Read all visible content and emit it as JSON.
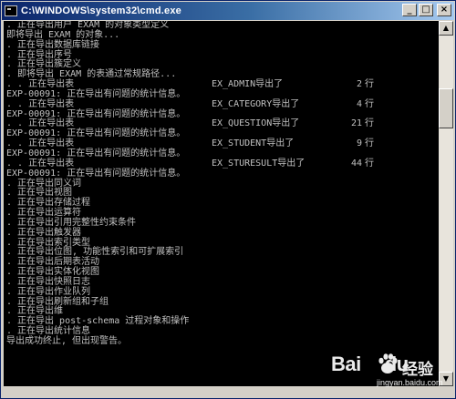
{
  "window": {
    "title": "C:\\WINDOWS\\system32\\cmd.exe",
    "controls": {
      "minimize": "_",
      "maximize": "□",
      "close": "×"
    }
  },
  "console": {
    "lines": [
      {
        "text": ". 正在导出用户 EXAM 的对象类型定义"
      },
      {
        "text": "即将导出 EXAM 的对象..."
      },
      {
        "text": ". 正在导出数据库链接"
      },
      {
        "text": ". 正在导出序号"
      },
      {
        "text": ". 正在导出簇定义"
      },
      {
        "text": ". 即将导出 EXAM 的表通过常规路径..."
      },
      {
        "text": ". . 正在导出表",
        "table": "EX_ADMIN导出了",
        "count": "2",
        "unit": "行"
      },
      {
        "text": "EXP-00091: 正在导出有问题的统计信息。"
      },
      {
        "text": ". . 正在导出表",
        "table": "EX_CATEGORY导出了",
        "count": "4",
        "unit": "行"
      },
      {
        "text": "EXP-00091: 正在导出有问题的统计信息。"
      },
      {
        "text": ". . 正在导出表",
        "table": "EX_QUESTION导出了",
        "count": "21",
        "unit": "行"
      },
      {
        "text": "EXP-00091: 正在导出有问题的统计信息。"
      },
      {
        "text": ". . 正在导出表",
        "table": "EX_STUDENT导出了",
        "count": "9",
        "unit": "行"
      },
      {
        "text": "EXP-00091: 正在导出有问题的统计信息。"
      },
      {
        "text": ". . 正在导出表",
        "table": "EX_STURESULT导出了",
        "count": "44",
        "unit": "行"
      },
      {
        "text": "EXP-00091: 正在导出有问题的统计信息。"
      },
      {
        "text": ". 正在导出同义词"
      },
      {
        "text": ". 正在导出视图"
      },
      {
        "text": ". 正在导出存储过程"
      },
      {
        "text": ". 正在导出运算符"
      },
      {
        "text": ". 正在导出引用完整性约束条件"
      },
      {
        "text": ". 正在导出触发器"
      },
      {
        "text": ". 正在导出索引类型"
      },
      {
        "text": ". 正在导出位图, 功能性索引和可扩展索引"
      },
      {
        "text": ". 正在导出后期表活动"
      },
      {
        "text": ". 正在导出实体化视图"
      },
      {
        "text": ". 正在导出快照日志"
      },
      {
        "text": ". 正在导出作业队列"
      },
      {
        "text": ". 正在导出刷新组和子组"
      },
      {
        "text": ". 正在导出维"
      },
      {
        "text": ". 正在导出 post-schema 过程对象和操作"
      },
      {
        "text": ". 正在导出统计信息"
      },
      {
        "text": "导出成功终止, 但出现警告。"
      }
    ]
  },
  "scrollbar": {
    "up_arrow": "▲",
    "down_arrow": "▼"
  },
  "watermark": {
    "logo": "Bai",
    "logo_suffix": "du",
    "brand_cn": "经验",
    "url": "jingyan.baidu.com"
  }
}
